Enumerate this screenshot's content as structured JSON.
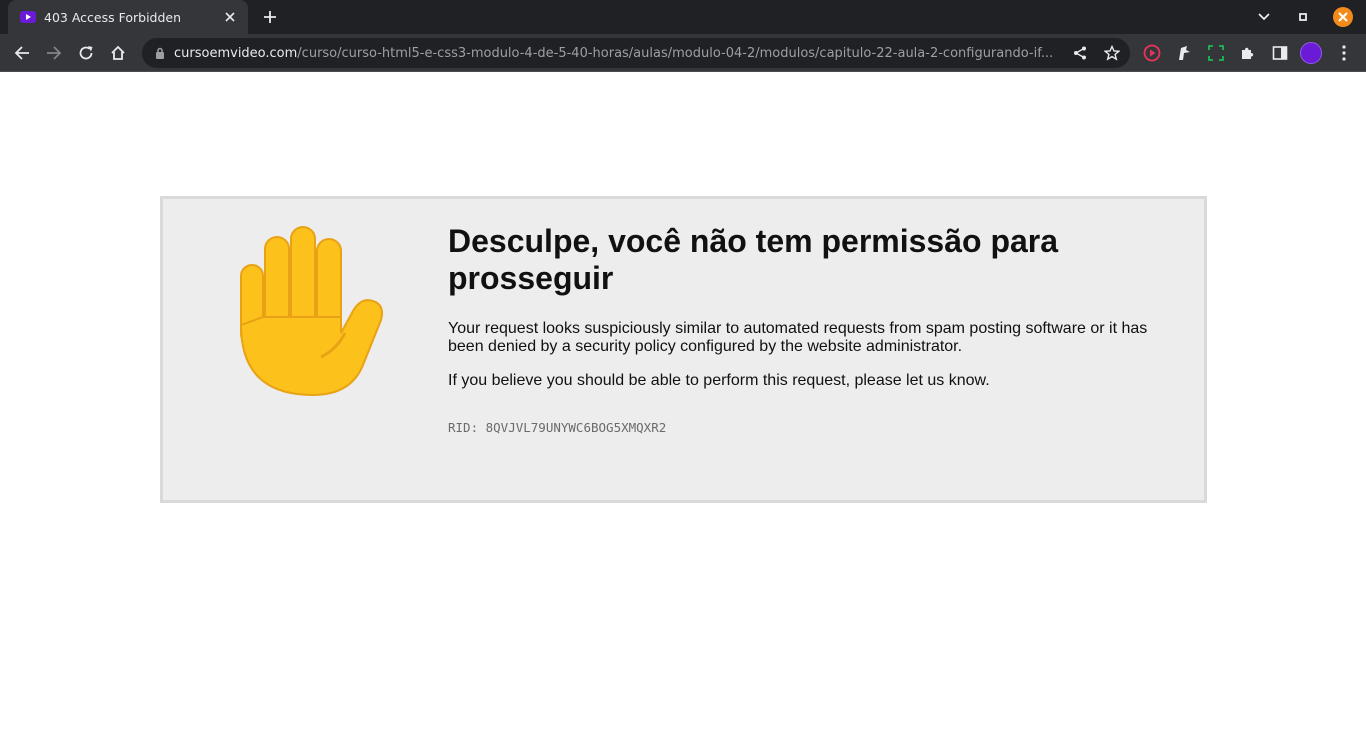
{
  "browser": {
    "tab": {
      "title": "403 Access Forbidden"
    },
    "address_bar": {
      "host": "cursoemvideo.com",
      "path": "/curso/curso-html5-e-css3-modulo-4-de-5-40-horas/aulas/modulo-04-2/modulos/capitulo-22-aula-2-configurando-if..."
    }
  },
  "page": {
    "title": "Desculpe, você não tem permissão para prosseguir",
    "message_1": "Your request looks suspiciously similar to automated requests from spam posting software or it has been denied by a security policy configured by the website administrator.",
    "message_2": "If you believe you should be able to perform this request, please let us know.",
    "rid": "RID: 8QVJVL79UNYWC6BOG5XMQXR2"
  },
  "colors": {
    "chrome_dark": "#202124",
    "chrome_toolbar": "#35363a",
    "box_background": "#ededed",
    "box_border": "#d9d9d9",
    "hand_yellow": "#fcc21b",
    "close_window": "#f28b1a"
  }
}
